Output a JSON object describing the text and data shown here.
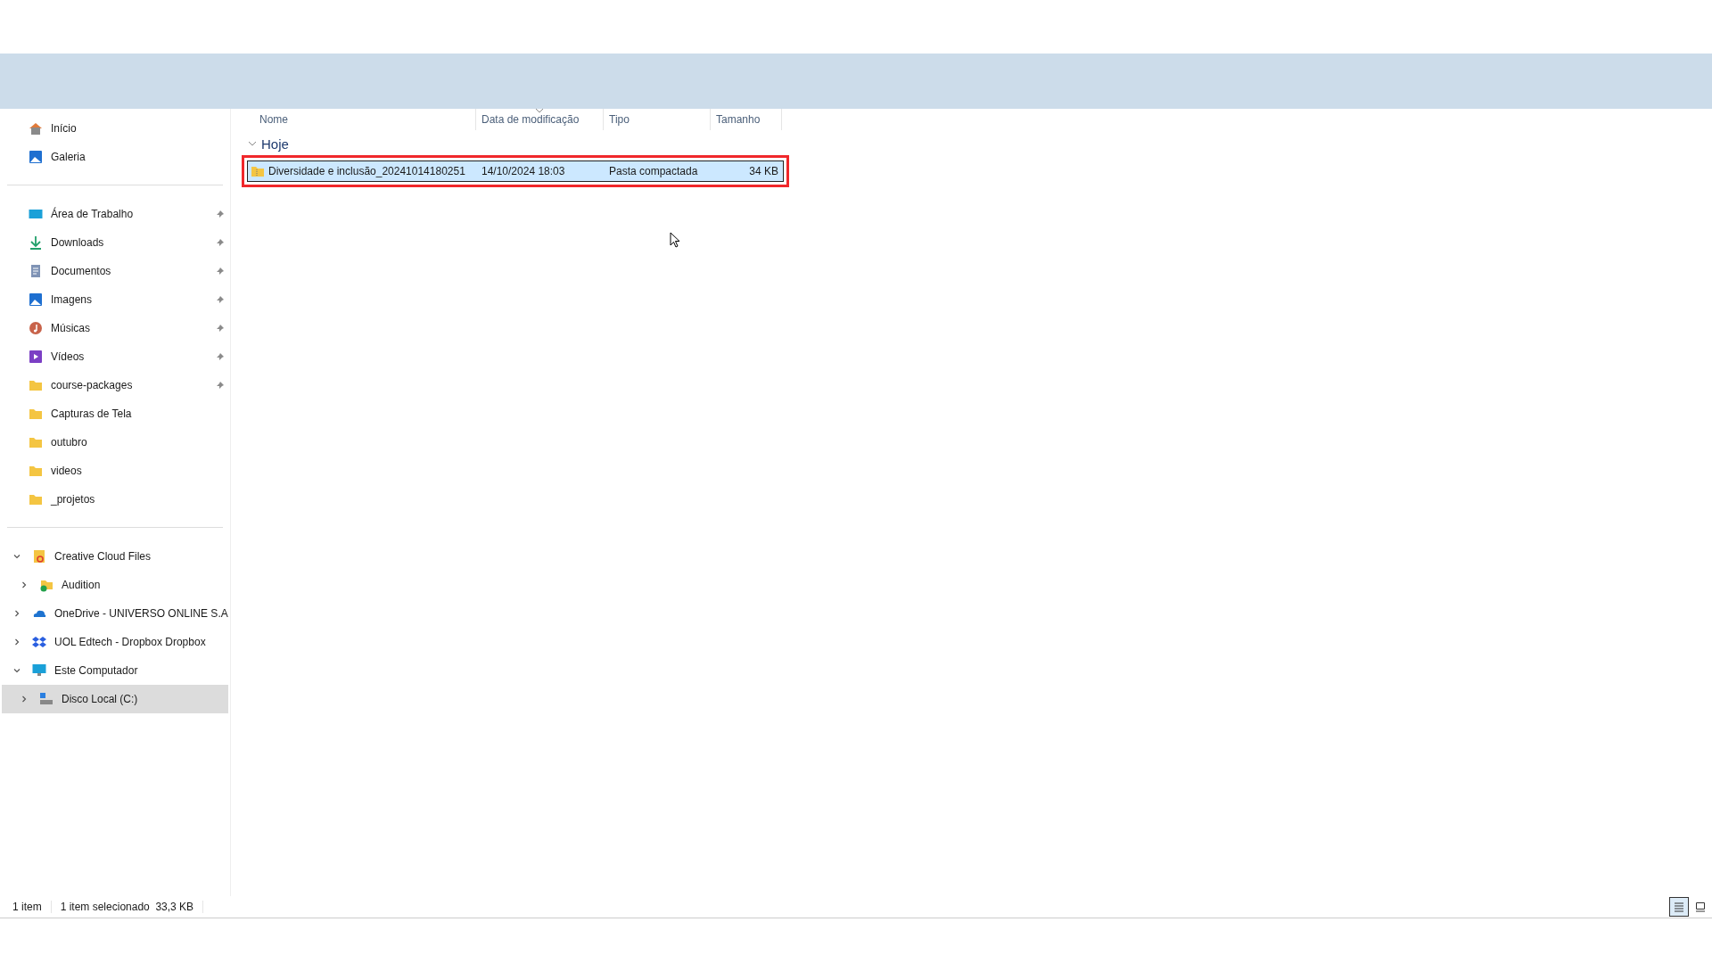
{
  "sidebar": {
    "quick": [
      {
        "label": "Início",
        "kind": "home",
        "selected": false
      },
      {
        "label": "Galeria",
        "kind": "gallery",
        "selected": false
      }
    ],
    "pinned": [
      {
        "label": "Área de Trabalho",
        "kind": "desktop",
        "pinned": true,
        "selected": false
      },
      {
        "label": "Downloads",
        "kind": "download",
        "pinned": true,
        "selected": false
      },
      {
        "label": "Documentos",
        "kind": "documents",
        "pinned": true,
        "selected": false
      },
      {
        "label": "Imagens",
        "kind": "pictures",
        "pinned": true,
        "selected": false
      },
      {
        "label": "Músicas",
        "kind": "music",
        "pinned": true,
        "selected": false
      },
      {
        "label": "Vídeos",
        "kind": "videos",
        "pinned": true,
        "selected": false
      },
      {
        "label": "course-packages",
        "kind": "folder",
        "pinned": true,
        "selected": false
      },
      {
        "label": "Capturas de Tela",
        "kind": "folder",
        "pinned": false,
        "selected": false
      },
      {
        "label": "outubro",
        "kind": "folder",
        "pinned": false,
        "selected": false
      },
      {
        "label": "videos",
        "kind": "folder",
        "pinned": false,
        "selected": false
      },
      {
        "label": "_projetos",
        "kind": "folder",
        "pinned": false,
        "selected": false
      }
    ],
    "tree": [
      {
        "label": "Creative Cloud Files",
        "kind": "cloud-files",
        "expanded": true,
        "selected": false,
        "children": [
          {
            "label": "Audition",
            "kind": "synced-folder",
            "expanded": false,
            "selected": false
          }
        ]
      },
      {
        "label": "OneDrive - UNIVERSO ONLINE S.A",
        "kind": "onedrive",
        "expanded": false,
        "selected": false
      },
      {
        "label": "UOL Edtech - Dropbox Dropbox",
        "kind": "dropbox",
        "expanded": false,
        "selected": false
      },
      {
        "label": "Este Computador",
        "kind": "computer",
        "expanded": true,
        "selected": false,
        "children": [
          {
            "label": "Disco Local (C:)",
            "kind": "drive",
            "expanded": false,
            "selected": true
          }
        ]
      }
    ]
  },
  "table": {
    "columns": [
      {
        "label": "Nome",
        "sorted": false
      },
      {
        "label": "Data de modificação",
        "sorted": true
      },
      {
        "label": "Tipo",
        "sorted": false
      },
      {
        "label": "Tamanho",
        "sorted": false
      }
    ],
    "groups": [
      {
        "label": "Hoje",
        "expanded": true,
        "rows": [
          {
            "name": "Diversidade e inclusão_20241014180251",
            "date": "14/10/2024 18:03",
            "type": "Pasta compactada",
            "size": "34 KB",
            "selected": true,
            "highlighted": true
          }
        ]
      }
    ]
  },
  "status_bar": {
    "count": "1 item",
    "selection": "1 item selecionado  33,3 KB",
    "views": [
      {
        "kind": "details",
        "selected": true
      },
      {
        "kind": "tiles",
        "selected": false
      }
    ]
  }
}
